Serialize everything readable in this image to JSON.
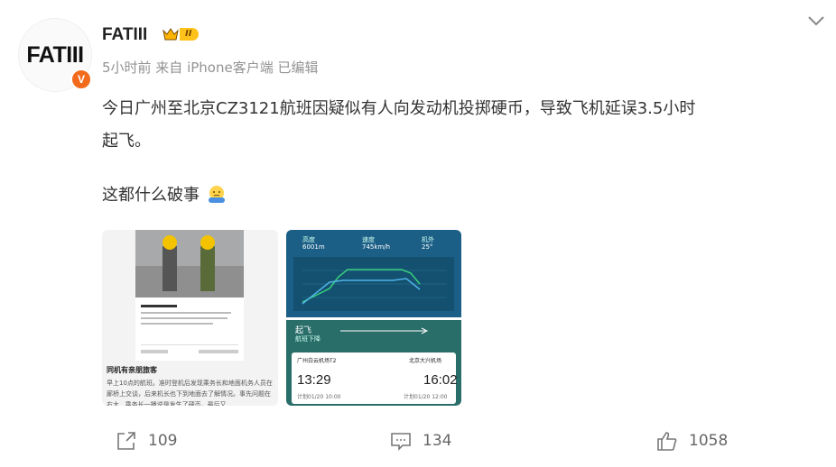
{
  "author": {
    "avatar_text": "FATIII",
    "verified_mark": "V",
    "name": "FATIII",
    "vip_level": "II",
    "meta": "5小时前  来自 iPhone客户端 已编辑"
  },
  "post": {
    "text_line1": "今日广州至北京CZ3121航班因疑似有人向发动机投掷硬币，导致飞机延误3.5小时",
    "text_line1b": "起飞。",
    "text_line2": "这都什么破事",
    "emoji": "shrug-emoji"
  },
  "image1": {
    "section_title": "同机有亲朋旅客",
    "body": "早上10点的航班。准时登机后发现乘务长和地面机务人员在廊桥上交谈，后来机长也下到地面去了解情况。事先问题在右大...乘务长一播说是发生了硬币，最后又..."
  },
  "image2": {
    "stats": [
      {
        "label": "高度",
        "value": "6001m"
      },
      {
        "label": "速度",
        "value": "745km/h"
      },
      {
        "label": "机外",
        "value": "25°"
      }
    ],
    "status": "起飞",
    "status_sub": "航班下降",
    "from_airport": "广州白云机场T2",
    "to_airport": "北京大兴机场",
    "dep_time": "13:29",
    "arr_time": "16:02",
    "dep_date": "计划01/20 10:00",
    "arr_date": "计划01/20 12:00"
  },
  "actions": {
    "share_count": "109",
    "comment_count": "134",
    "like_count": "1058"
  },
  "colors": {
    "accent": "#f26b1d",
    "vip": "#ffc21a",
    "meta": "#939393"
  }
}
